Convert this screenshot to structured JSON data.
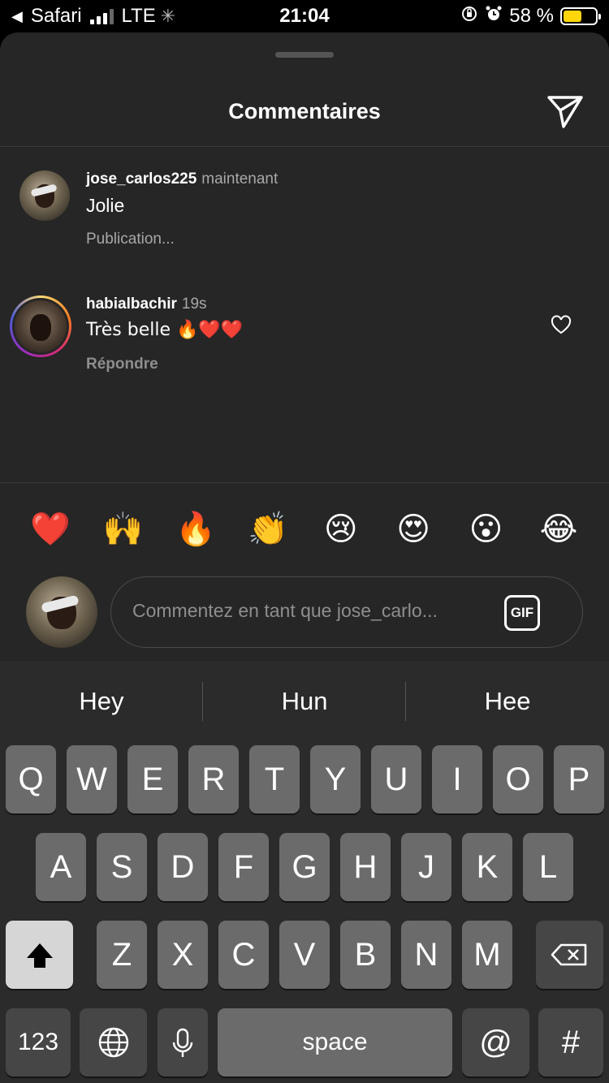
{
  "status_bar": {
    "back_app": "Safari",
    "network": "LTE",
    "time": "21:04",
    "battery_percent": "58 %",
    "battery_level": 0.58,
    "icons": [
      "back-arrow-icon",
      "signal-bars-icon",
      "loading-spinner-icon",
      "orientation-lock-icon",
      "alarm-icon",
      "battery-icon"
    ]
  },
  "sheet": {
    "title": "Commentaires",
    "send_icon": "paper-plane-icon"
  },
  "comments": [
    {
      "username": "jose_carlos225",
      "time": "maintenant",
      "text": "Jolie",
      "sub": "Publication..."
    },
    {
      "username": "habialbachir",
      "time": "19s",
      "text": "Très belle 🔥❤️❤️",
      "sub": "Répondre",
      "like_icon": "heart-outline-icon"
    }
  ],
  "emoji_bar": [
    "❤️",
    "🙌",
    "🔥",
    "👏",
    "😢",
    "😍",
    "😮",
    "😂"
  ],
  "composer": {
    "placeholder": "Commentez en tant que jose_carlo...",
    "gif_label": "GIF"
  },
  "keyboard": {
    "suggestions": [
      "Hey",
      "Hun",
      "Hee"
    ],
    "row1": [
      "Q",
      "W",
      "E",
      "R",
      "T",
      "Y",
      "U",
      "I",
      "O",
      "P"
    ],
    "row2": [
      "A",
      "S",
      "D",
      "F",
      "G",
      "H",
      "J",
      "K",
      "L"
    ],
    "row3": [
      "Z",
      "X",
      "C",
      "V",
      "B",
      "N",
      "M"
    ],
    "numbers_label": "123",
    "space_label": "space",
    "at_label": "@",
    "hash_label": "#"
  },
  "colors": {
    "sheet_bg": "#262626",
    "keyboard_bg": "#2b2b2b",
    "key_bg": "#6b6b6b",
    "battery": "#ffd60a"
  }
}
